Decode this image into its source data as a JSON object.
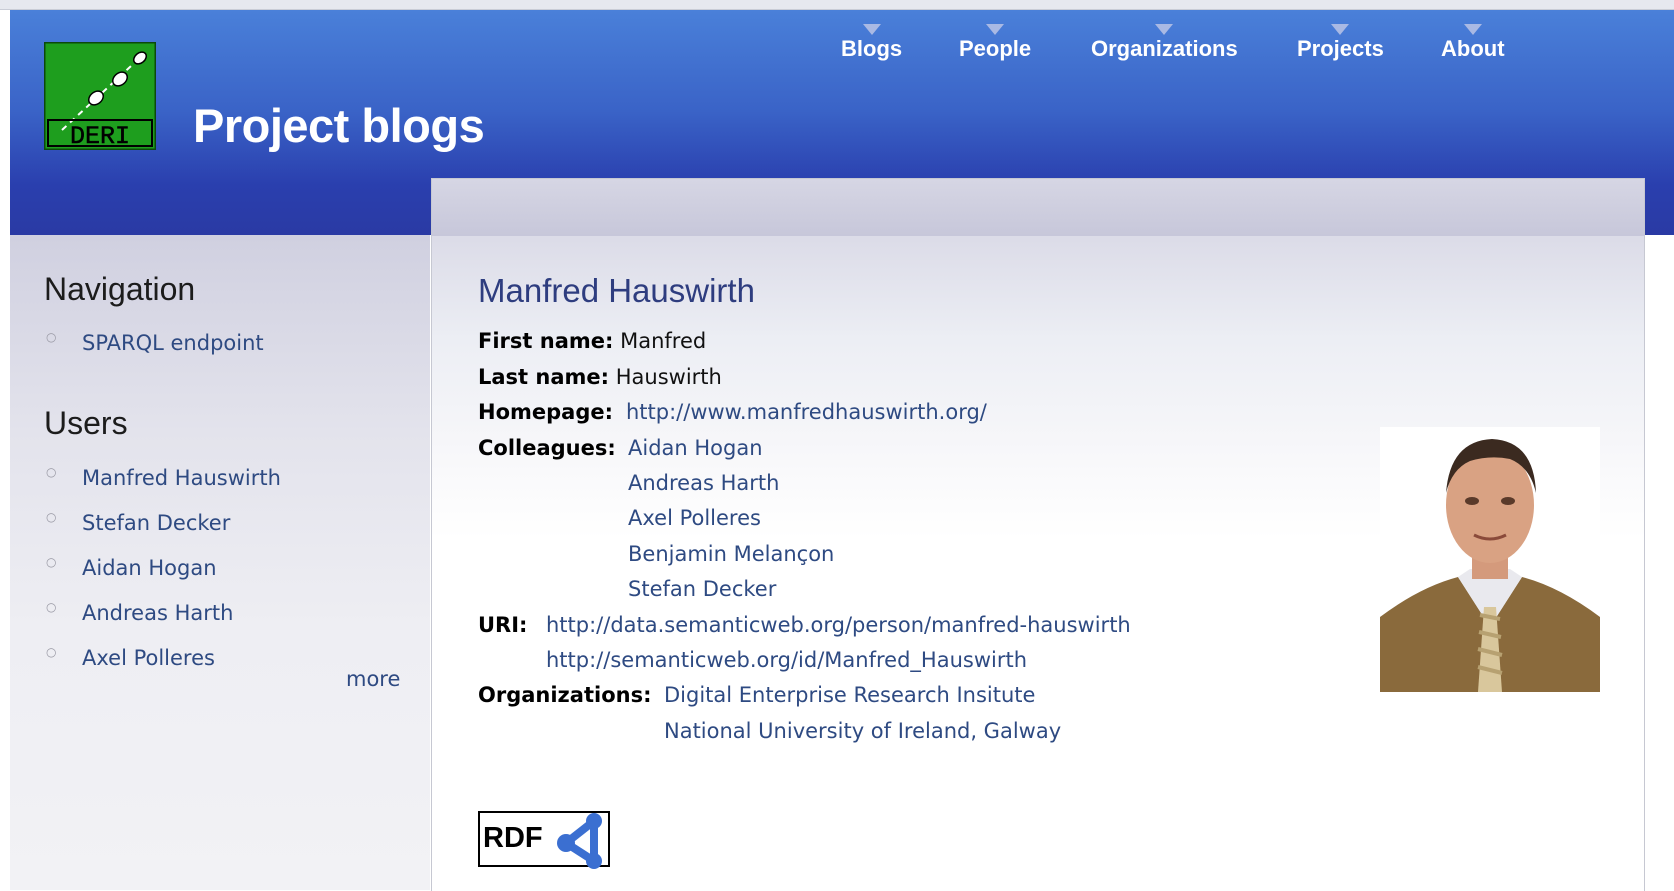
{
  "header": {
    "title": "Project blogs",
    "logo_text": "DERI",
    "nav": [
      {
        "label": "Blogs"
      },
      {
        "label": "People"
      },
      {
        "label": "Organizations"
      },
      {
        "label": "Projects"
      },
      {
        "label": "About"
      }
    ]
  },
  "sidebar": {
    "navigation_heading": "Navigation",
    "navigation_items": [
      {
        "label": "SPARQL endpoint"
      }
    ],
    "users_heading": "Users",
    "users": [
      {
        "label": "Manfred Hauswirth"
      },
      {
        "label": "Stefan Decker"
      },
      {
        "label": "Aidan Hogan"
      },
      {
        "label": "Andreas Harth"
      },
      {
        "label": "Axel Polleres"
      }
    ],
    "more_label": "more"
  },
  "profile": {
    "name": "Manfred Hauswirth",
    "first_name_label": "First name:",
    "first_name": "Manfred",
    "last_name_label": "Last name:",
    "last_name": "Hauswirth",
    "homepage_label": "Homepage:",
    "homepage": "http://www.manfredhauswirth.org/",
    "colleagues_label": "Colleagues:",
    "colleagues": [
      "Aidan Hogan",
      "Andreas Harth",
      "Axel Polleres",
      "Benjamin Melançon",
      "Stefan Decker"
    ],
    "uri_label": "URI:",
    "uris": [
      "http://data.semanticweb.org/person/manfred-hauswirth",
      "http://semanticweb.org/id/Manfred_Hauswirth"
    ],
    "organizations_label": "Organizations:",
    "organizations": [
      "Digital Enterprise Research Insitute",
      "National University of Ireland, Galway"
    ],
    "rdf_badge_text": "RDF"
  },
  "colors": {
    "header_top": "#4a80d9",
    "header_bottom": "#2a3aa4",
    "link": "#2e4a82",
    "name_heading": "#2e3d7f",
    "logo_green": "#1e9e1e"
  }
}
